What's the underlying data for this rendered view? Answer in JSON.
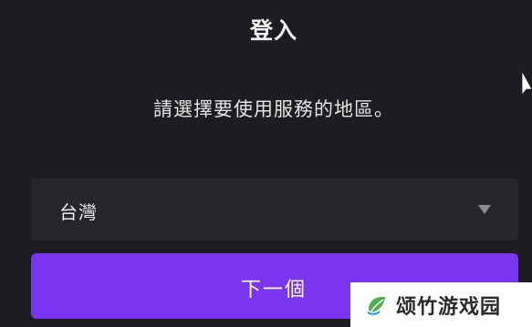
{
  "dialog": {
    "title": "登入",
    "subtitle": "請選擇要使用服務的地區。",
    "region_select": {
      "selected": "台灣"
    },
    "next_button_label": "下一個"
  },
  "watermark": {
    "text": "颂竹游戏园"
  },
  "colors": {
    "background": "#1c1c21",
    "select_background": "#26262b",
    "accent": "#7b35f0"
  },
  "icons": {
    "cursor": "mouse-pointer-icon",
    "dropdown": "triangle-down-icon",
    "watermark_logo": "leaf-logo-icon"
  }
}
